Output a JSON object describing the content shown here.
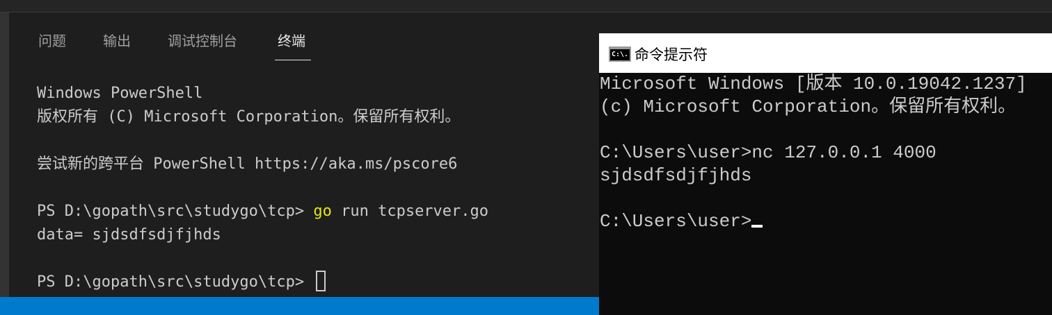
{
  "vscode": {
    "tabs": [
      {
        "label": "问题"
      },
      {
        "label": "输出"
      },
      {
        "label": "调试控制台"
      },
      {
        "label": "终端"
      }
    ],
    "active_tab": "终端",
    "terminal_lines": [
      "Windows PowerShell",
      "版权所有 (C) Microsoft Corporation。保留所有权利。",
      "",
      "尝试新的跨平台 PowerShell https://aka.ms/pscore6",
      "",
      "PS D:\\gopath\\src\\studygo\\tcp> ",
      "data= sjdsdfsdjfjhds",
      "",
      "PS D:\\gopath\\src\\studygo\\tcp> "
    ],
    "command_keyword": "go",
    "command_rest": " run tcpserver.go",
    "colors": {
      "background": "#1e1e1e",
      "text": "#cccccc",
      "command_highlight": "#e5e510",
      "status_bar": "#007acc"
    }
  },
  "cmd": {
    "title": "命令提示符",
    "icon": {
      "name": "cmd-app-icon",
      "text": "C:\\."
    },
    "lines": [
      "Microsoft Windows [版本 10.0.19042.1237]",
      "(c) Microsoft Corporation。保留所有权利。",
      "",
      "C:\\Users\\user>nc 127.0.0.1 4000",
      "sjdsdfsdjfjhds",
      "",
      "C:\\Users\\user>"
    ],
    "colors": {
      "background": "#0c0c0c",
      "text": "#cccccc",
      "titlebar": "#ffffff"
    }
  }
}
